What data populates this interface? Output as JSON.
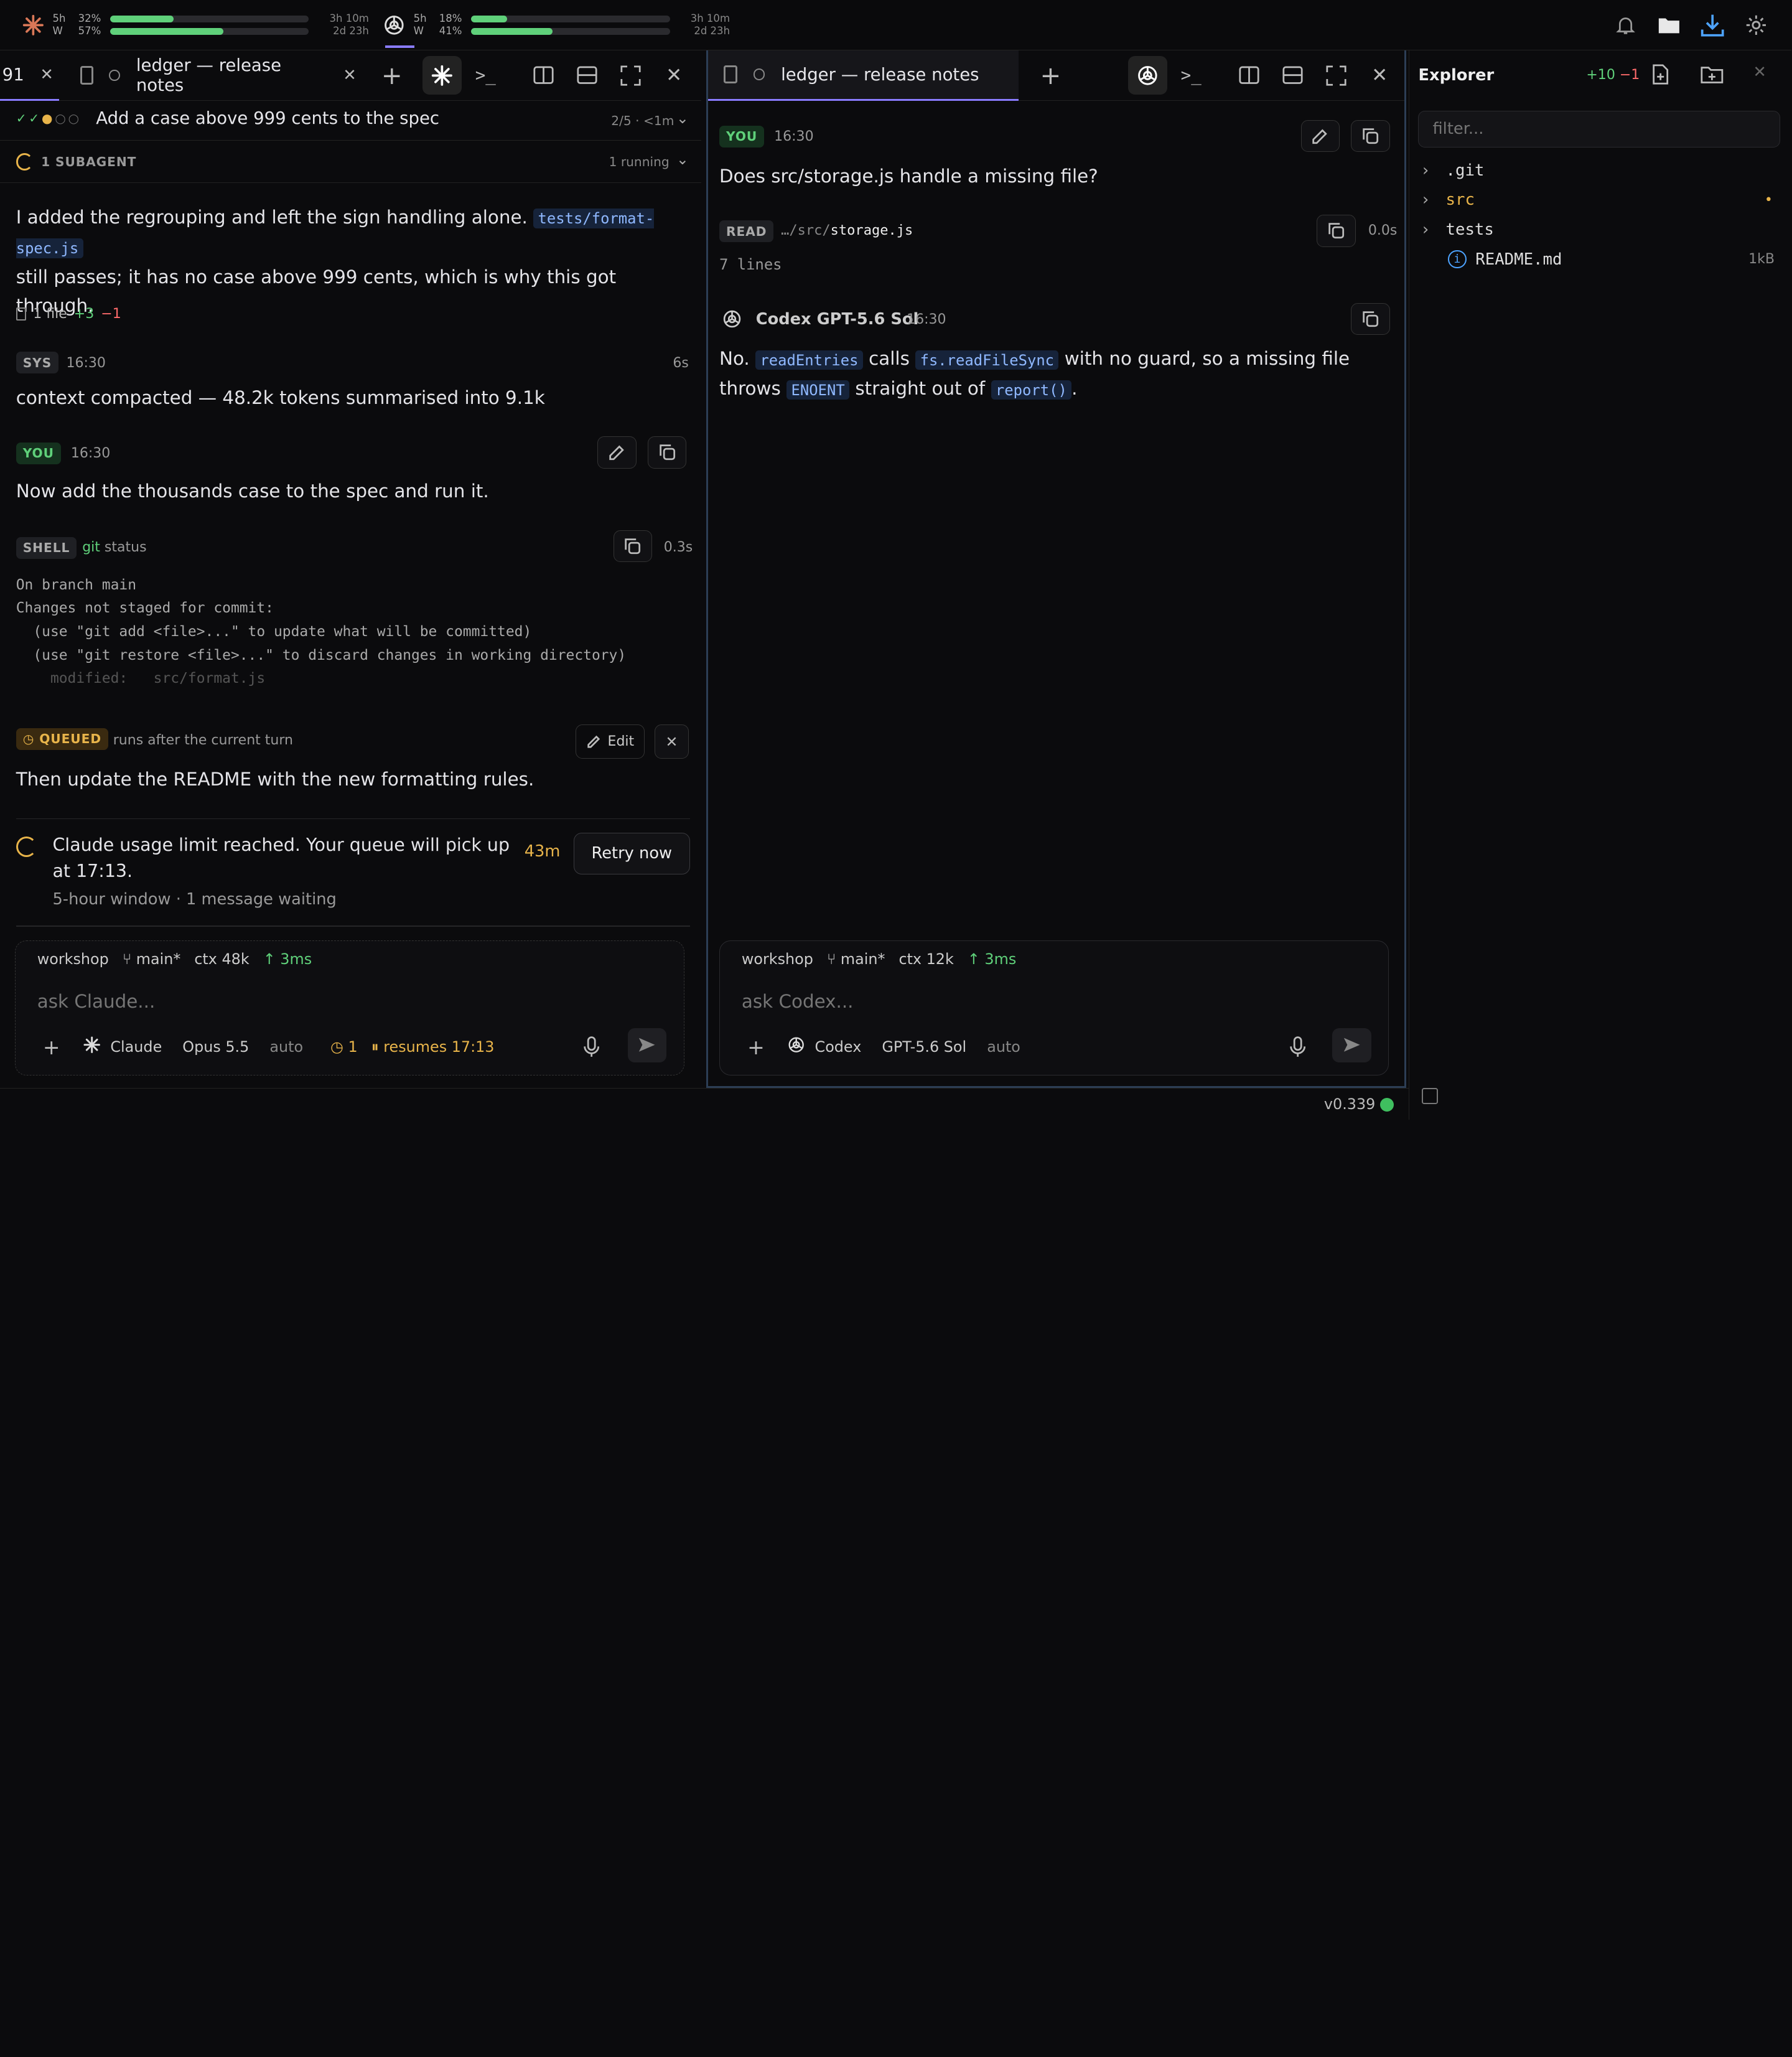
{
  "topbar": {
    "claude": {
      "w1": "5h",
      "w2": "W",
      "p1": "32%",
      "p2": "57%",
      "v1": 0.32,
      "v2": 0.57,
      "r1": "3h 10m",
      "r2": "2d 23h"
    },
    "codex": {
      "w1": "5h",
      "w2": "W",
      "p1": "18%",
      "p2": "41%",
      "v1": 0.18,
      "v2": 0.41,
      "r1": "3h 10m",
      "r2": "2d 23h"
    }
  },
  "left": {
    "tab_cut": "91",
    "tab_title": "ledger — release notes",
    "plan_title": "Add a case above 999 cents to the spec",
    "plan_meta": "2/5 · <1m",
    "subagent_label": "1 SUBAGENT",
    "subagent_meta": "1 running",
    "msg1_a": "I added the regrouping and left the sign handling alone.",
    "msg1_code": "tests/format-spec.js",
    "msg1_b": "still passes; it has no case above 999 cents, which is why this got through.",
    "files_label": "1 file",
    "files_add": "+3",
    "files_del": "−1",
    "sys_badge": "SYS",
    "sys_time": "16:30",
    "sys_dur": "6s",
    "sys_text": "context compacted — 48.2k tokens summarised into 9.1k",
    "you_badge": "YOU",
    "you_time": "16:30",
    "you_text": "Now add the thousands case to the spec and run it.",
    "shell_badge": "SHELL",
    "shell_cmd1": "git",
    "shell_cmd2": "status",
    "shell_dur": "0.3s",
    "shell_out": [
      "On branch main",
      "Changes not staged for commit:",
      "  (use \"git add <file>...\" to update what will be committed)",
      "  (use \"git restore <file>...\" to discard changes in working directory)",
      "    modified:   src/format.js"
    ],
    "queued_badge": "QUEUED",
    "queued_meta": "runs after the current turn",
    "edit_label": "Edit",
    "queued_text": "Then update the README with the new formatting rules.",
    "limit_text": "Claude usage limit reached. Your queue will pick up at 17:13.",
    "limit_time": "43m",
    "retry_label": "Retry now",
    "limit_sub": "5-hour window · 1 message waiting",
    "input": {
      "ws": "workshop",
      "branch": "main*",
      "ctx": "ctx 48k",
      "ms": "↑ 3ms",
      "placeholder": "ask Claude...",
      "agent": "Claude",
      "model": "Opus 5.5",
      "mode": "auto",
      "queue": "1",
      "resumes": "resumes 17:13"
    }
  },
  "right": {
    "tab_title": "ledger — release notes",
    "you_badge": "YOU",
    "you_time": "16:30",
    "you_text": "Does src/storage.js handle a missing file?",
    "read_badge": "READ",
    "read_path_a": "…/src/",
    "read_path_b": "storage.js",
    "read_dur": "0.0s",
    "read_lines": "7 lines",
    "bot_name": "Codex GPT-5.6 Sol",
    "bot_time": "16:30",
    "ans_a": "No.",
    "ans_c1": "readEntries",
    "ans_b": "calls",
    "ans_c2": "fs.readFileSync",
    "ans_c": "with no guard, so a missing file",
    "ans_d": "throws",
    "ans_c3": "ENOENT",
    "ans_e": "straight out of",
    "ans_c4": "report()",
    "ans_f": ".",
    "input": {
      "ws": "workshop",
      "branch": "main*",
      "ctx": "ctx 12k",
      "ms": "↑ 3ms",
      "placeholder": "ask Codex...",
      "agent": "Codex",
      "model": "GPT-5.6 Sol",
      "mode": "auto"
    }
  },
  "explorer": {
    "title": "Explorer",
    "add": "+10",
    "del": "−1",
    "filter_placeholder": "filter...",
    "items": [
      {
        "name": ".git",
        "type": "dir"
      },
      {
        "name": "src",
        "type": "dir",
        "modified": "•"
      },
      {
        "name": "tests",
        "type": "dir"
      },
      {
        "name": "README.md",
        "type": "file",
        "size": "1kB"
      }
    ]
  },
  "status": {
    "version": "v0.339"
  }
}
